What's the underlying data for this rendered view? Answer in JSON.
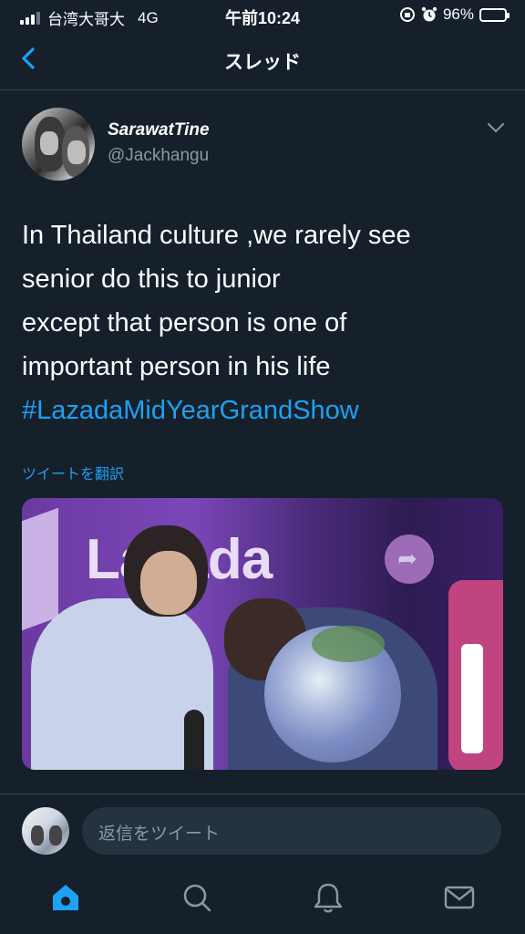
{
  "status_bar": {
    "carrier": "台湾大哥大",
    "network": "4G",
    "time": "午前10:24",
    "battery": "96%",
    "battery_level": 0.96
  },
  "nav": {
    "title": "スレッド"
  },
  "tweet": {
    "display_name": "SarawatTine",
    "handle": "@Jackhangu",
    "lines": [
      "In Thailand culture ,we rarely see",
      "senior do this to junior",
      "except that person is one of",
      "important person in his life"
    ],
    "hashtag": "#LazadaMidYearGrandShow",
    "translate_label": "ツイートを翻訳",
    "media_logo_text": "Lazada"
  },
  "reply": {
    "placeholder": "返信をツイート"
  },
  "tabs": [
    {
      "icon": "home-icon"
    },
    {
      "icon": "search-icon"
    },
    {
      "icon": "notifications-icon"
    },
    {
      "icon": "messages-icon"
    }
  ],
  "colors": {
    "background": "#15202b",
    "accent": "#1da1f2",
    "secondary_text": "#8899a6",
    "divider": "#38444d"
  }
}
